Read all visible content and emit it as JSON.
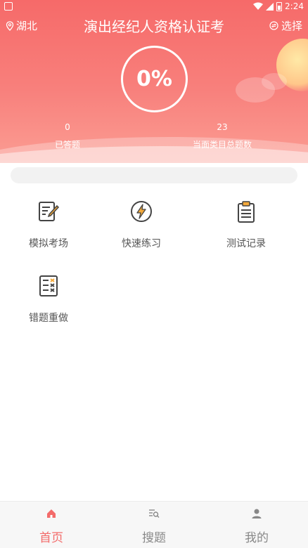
{
  "status_bar": {
    "time": "2:24"
  },
  "header": {
    "location": "湖北",
    "title": "演出经纪人资格认证考",
    "select_label": "选择",
    "progress": "0%",
    "stats": [
      {
        "value": "0",
        "label": "已答题"
      },
      {
        "value": "23",
        "label": "当面类目总题数"
      }
    ]
  },
  "menu": [
    {
      "label": "模拟考场",
      "icon": "exam-edit-icon"
    },
    {
      "label": "快速练习",
      "icon": "lightning-icon"
    },
    {
      "label": "测试记录",
      "icon": "clipboard-icon"
    },
    {
      "label": "错题重做",
      "icon": "wrong-questions-icon"
    }
  ],
  "bottom_nav": [
    {
      "label": "首页",
      "icon": "home-icon",
      "active": true
    },
    {
      "label": "搜题",
      "icon": "search-questions-icon",
      "active": false
    },
    {
      "label": "我的",
      "icon": "person-icon",
      "active": false
    }
  ],
  "colors": {
    "accent": "#f36b6a",
    "header_top": "#f66a69",
    "header_bottom": "#fb9d93"
  }
}
